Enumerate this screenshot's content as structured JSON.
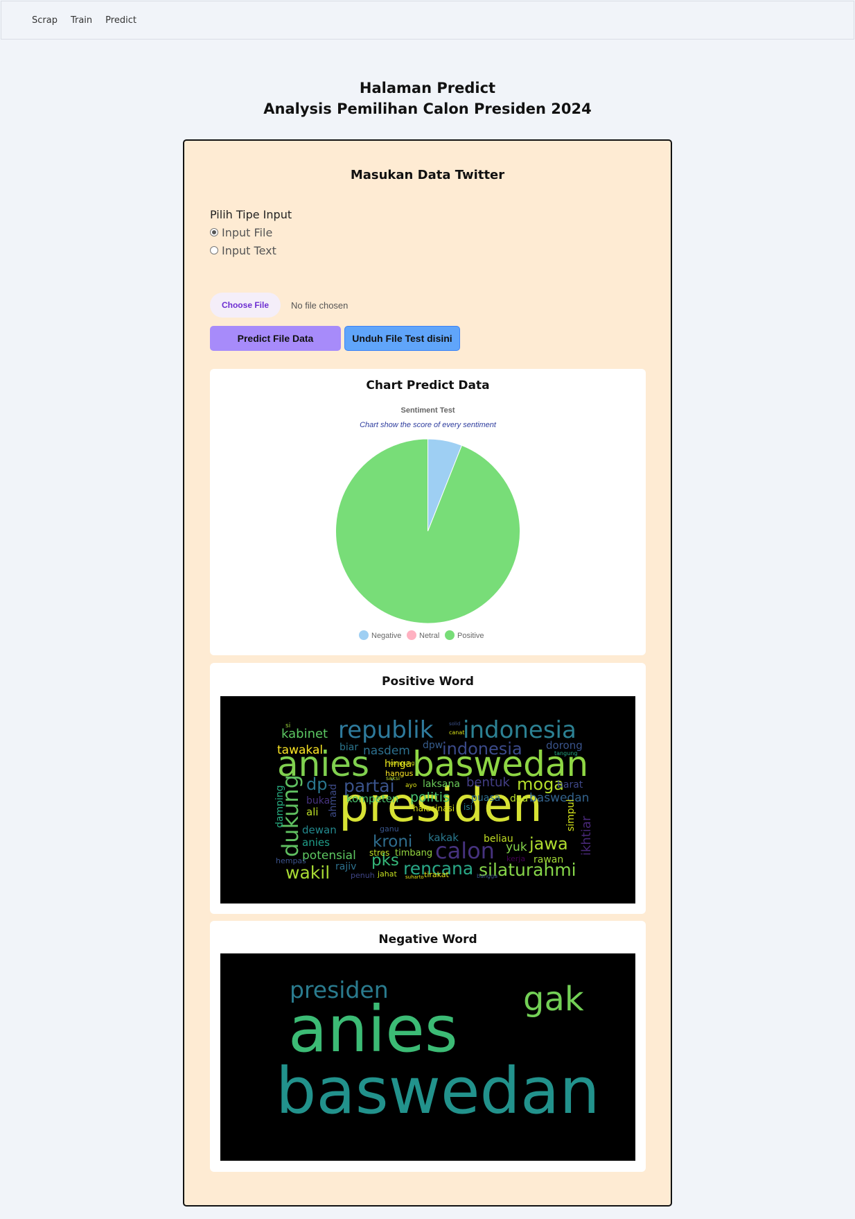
{
  "nav": {
    "items": [
      "Scrap",
      "Train",
      "Predict"
    ]
  },
  "heading": {
    "line1": "Halaman Predict",
    "line2": "Analysis Pemilihan Calon Presiden 2024"
  },
  "form": {
    "title": "Masukan Data Twitter",
    "input_type_label": "Pilih Tipe Input",
    "options": [
      {
        "label": "Input File",
        "checked": true
      },
      {
        "label": "Input Text",
        "checked": false
      }
    ],
    "choose_file_label": "Choose File",
    "no_file_text": "No file chosen",
    "predict_button": "Predict File Data",
    "download_button": "Unduh File Test disini"
  },
  "chart_panel_title": "Chart Predict Data",
  "chart_data": {
    "type": "pie",
    "title": "Sentiment Test",
    "subtitle": "Chart show the score of every sentiment",
    "categories": [
      "Negative",
      "Netral",
      "Positive"
    ],
    "values": [
      6,
      0,
      94
    ],
    "colors": [
      "#9ecff3",
      "#ffb1c1",
      "#78dd78"
    ],
    "legend": "bottom"
  },
  "positive_word": {
    "title": "Positive Word",
    "words": [
      {
        "text": "presiden",
        "color": "#d7e234"
      },
      {
        "text": "anies",
        "color": "#80d04f"
      },
      {
        "text": "baswedan",
        "color": "#8fd744"
      },
      {
        "text": "republik",
        "color": "#2e7a9c"
      },
      {
        "text": "indonesia",
        "color": "#2c8193"
      },
      {
        "text": "indonesia",
        "color": "#3b4a8a"
      },
      {
        "text": "calon",
        "color": "#46327e"
      },
      {
        "text": "dukung",
        "color": "#5fbf60"
      },
      {
        "text": "partai",
        "color": "#3a538b"
      },
      {
        "text": "silaturahmi",
        "color": "#86d549"
      },
      {
        "text": "rencana",
        "color": "#29a987"
      },
      {
        "text": "wakil",
        "color": "#a8db34"
      },
      {
        "text": "kroni",
        "color": "#2f6d8e"
      },
      {
        "text": "jawa",
        "color": "#b0dd2f"
      },
      {
        "text": "moga",
        "color": "#b5de2b"
      },
      {
        "text": "kabinet",
        "color": "#5cc863"
      },
      {
        "text": "tawakal",
        "color": "#fde725"
      },
      {
        "text": "dp",
        "color": "#2a768e"
      },
      {
        "text": "pks",
        "color": "#35b779"
      },
      {
        "text": "politis",
        "color": "#48c16e"
      },
      {
        "text": "nasdem",
        "color": "#2d708e"
      },
      {
        "text": "bentuk",
        "color": "#433e85"
      },
      {
        "text": "potensial",
        "color": "#5ec962"
      },
      {
        "text": "baswedan",
        "color": "#33638d"
      },
      {
        "text": "laksana",
        "color": "#6ccd5a"
      },
      {
        "text": "kompeten",
        "color": "#4ac16d"
      },
      {
        "text": "dorong",
        "color": "#3a548c"
      },
      {
        "text": "ikhtiar",
        "color": "#482878"
      },
      {
        "text": "damping",
        "color": "#27ad81"
      },
      {
        "text": "dewan",
        "color": "#23898e"
      },
      {
        "text": "kakak",
        "color": "#2a788e"
      },
      {
        "text": "beliau",
        "color": "#c2df23"
      },
      {
        "text": "yuk",
        "color": "#84d44b"
      },
      {
        "text": "simpul",
        "color": "#d2e21b"
      },
      {
        "text": "ali",
        "color": "#bddf26"
      },
      {
        "text": "ahmad",
        "color": "#3e4c8a"
      },
      {
        "text": "puasa",
        "color": "#2e6e8e"
      },
      {
        "text": "anies",
        "color": "#1f9e89"
      },
      {
        "text": "rawan",
        "color": "#a2da37"
      },
      {
        "text": "buka",
        "color": "#46337f"
      },
      {
        "text": "doa",
        "color": "#b8de29"
      },
      {
        "text": "timbang",
        "color": "#95d840"
      },
      {
        "text": "rajiv",
        "color": "#2d718e"
      },
      {
        "text": "hinga",
        "color": "#ece51b"
      },
      {
        "text": "halusinasi",
        "color": "#dde318"
      },
      {
        "text": "tirakat",
        "color": "#e5e419"
      },
      {
        "text": "barat",
        "color": "#3f4889"
      },
      {
        "text": "dpw",
        "color": "#365c8d"
      },
      {
        "text": "biar",
        "color": "#2b758e"
      },
      {
        "text": "hangus",
        "color": "#fde725"
      },
      {
        "text": "stres",
        "color": "#c0df25"
      },
      {
        "text": "penuh",
        "color": "#404688"
      },
      {
        "text": "jahat",
        "color": "#c5e021"
      },
      {
        "text": "hempas",
        "color": "#3b528b"
      },
      {
        "text": "kampung",
        "color": "#d5e21a"
      },
      {
        "text": "saksi",
        "color": "#bade28"
      },
      {
        "text": "ayo",
        "color": "#dde318"
      },
      {
        "text": "isi",
        "color": "#277f8e"
      },
      {
        "text": "canat",
        "color": "#d8e219"
      },
      {
        "text": "tangung",
        "color": "#25ab82"
      },
      {
        "text": "si",
        "color": "#9dd93b"
      },
      {
        "text": "solid",
        "color": "#3b528b"
      },
      {
        "text": "kerja",
        "color": "#440154"
      },
      {
        "text": "ganu",
        "color": "#39558c"
      },
      {
        "text": "suharto",
        "color": "#e7e419"
      },
      {
        "text": "bangga",
        "color": "#3b528b"
      }
    ]
  },
  "negative_word": {
    "title": "Negative Word",
    "words": [
      {
        "text": "anies",
        "color": "#3cbb75"
      },
      {
        "text": "baswedan",
        "color": "#22928c"
      },
      {
        "text": "presiden",
        "color": "#2a7b8e"
      },
      {
        "text": "gak",
        "color": "#73d056"
      }
    ]
  }
}
